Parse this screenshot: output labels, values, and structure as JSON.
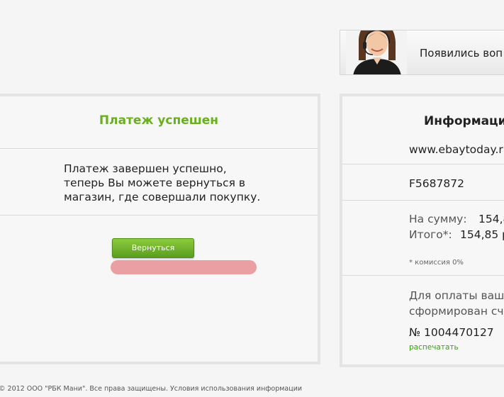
{
  "support": {
    "text": "Появились воп",
    "avatar_icon": "operator-headset-icon"
  },
  "payment": {
    "title": "Платеж успешен",
    "message_lines": [
      "Платеж завершен успешно,",
      "теперь Вы можете вернуться в",
      "магазин, где совершали покупку."
    ],
    "back_button": "Вернуться"
  },
  "info": {
    "title": "Информаци",
    "shop": "www.ebaytoday.r",
    "order_id": "F5687872",
    "amount_label": "На сумму:",
    "amount_value": "154,8",
    "total_label": "Итого*:",
    "total_value": "154,85 р",
    "commission_note": "* комиссия 0%",
    "invoice_line1": "Для оплаты ваш",
    "invoice_line2": "сформирован сч",
    "invoice_number": "№ 1004470127",
    "print_link": "распечатать"
  },
  "footer": {
    "text": "© 2012 ООО \"РБК Мани\". Все права защищены. Условия использования информации"
  },
  "colors": {
    "accent_green": "#6aaf1f",
    "button_green": "#5a9e1f",
    "redaction": "#e88f93"
  }
}
